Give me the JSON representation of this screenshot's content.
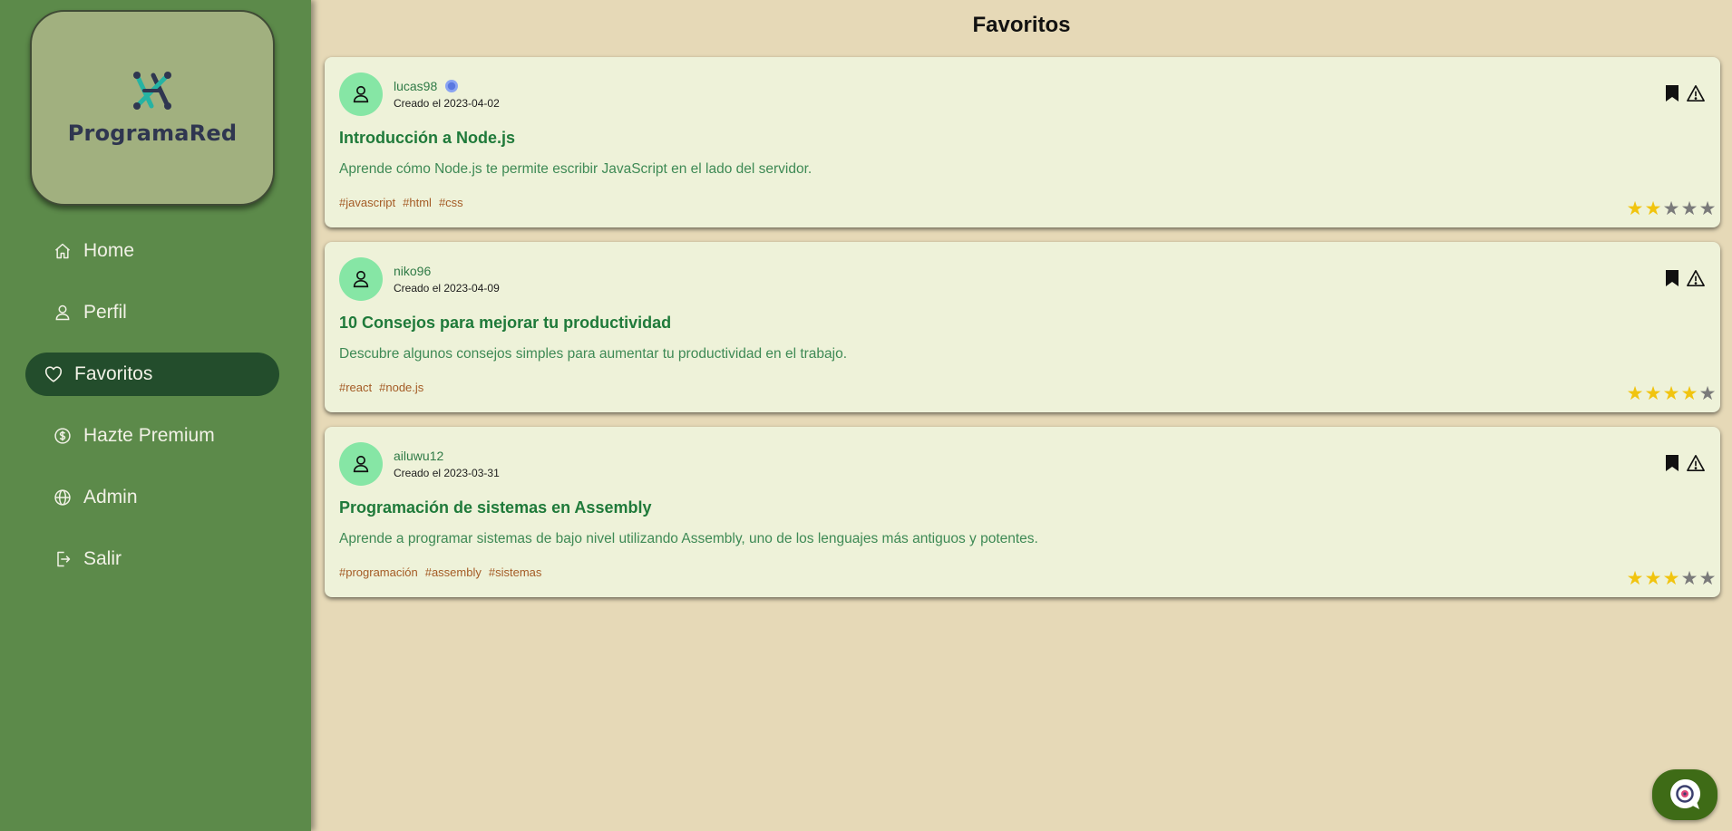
{
  "app": {
    "name": "ProgramaRed",
    "logo_icon": "programared-logo-icon"
  },
  "sidebar": {
    "items": [
      {
        "label": "Home",
        "icon": "home-icon",
        "active": false
      },
      {
        "label": "Perfil",
        "icon": "user-icon",
        "active": false
      },
      {
        "label": "Favoritos",
        "icon": "heart-icon",
        "active": true
      },
      {
        "label": "Hazte Premium",
        "icon": "dollar-circle-icon",
        "active": false
      },
      {
        "label": "Admin",
        "icon": "globe-icon",
        "active": false
      },
      {
        "label": "Salir",
        "icon": "logout-icon",
        "active": false
      }
    ]
  },
  "page": {
    "title": "Favoritos"
  },
  "posts": [
    {
      "username": "lucas98",
      "verified": true,
      "created": "Creado el 2023-04-02",
      "title": "Introducción a Node.js",
      "description": "Aprende cómo Node.js te permite escribir JavaScript en el lado del servidor.",
      "tags": [
        "#javascript",
        "#html",
        "#css"
      ],
      "rating": 2,
      "rating_max": 5
    },
    {
      "username": "niko96",
      "verified": false,
      "created": "Creado el 2023-04-09",
      "title": "10 Consejos para mejorar tu productividad",
      "description": "Descubre algunos consejos simples para aumentar tu productividad en el trabajo.",
      "tags": [
        "#react",
        "#node.js"
      ],
      "rating": 4,
      "rating_max": 5
    },
    {
      "username": "ailuwu12",
      "verified": false,
      "created": "Creado el 2023-03-31",
      "title": "Programación de sistemas en Assembly",
      "description": "Aprende a programar sistemas de bajo nivel utilizando Assembly, uno de los lenguajes más antiguos y potentes.",
      "tags": [
        "#programación",
        "#assembly",
        "#sistemas"
      ],
      "rating": 3,
      "rating_max": 5
    }
  ],
  "colors": {
    "sidebar_bg": "#5c8a4a",
    "active_nav": "#234d2c",
    "page_bg": "#e6d9b7",
    "card_bg": "#eef2d9",
    "avatar_bg": "#86e6a5",
    "star_on": "#f1c40f",
    "star_off": "#7a7a7a",
    "tag": "#a45b25"
  },
  "chat": {
    "icon": "chatbot-icon"
  }
}
